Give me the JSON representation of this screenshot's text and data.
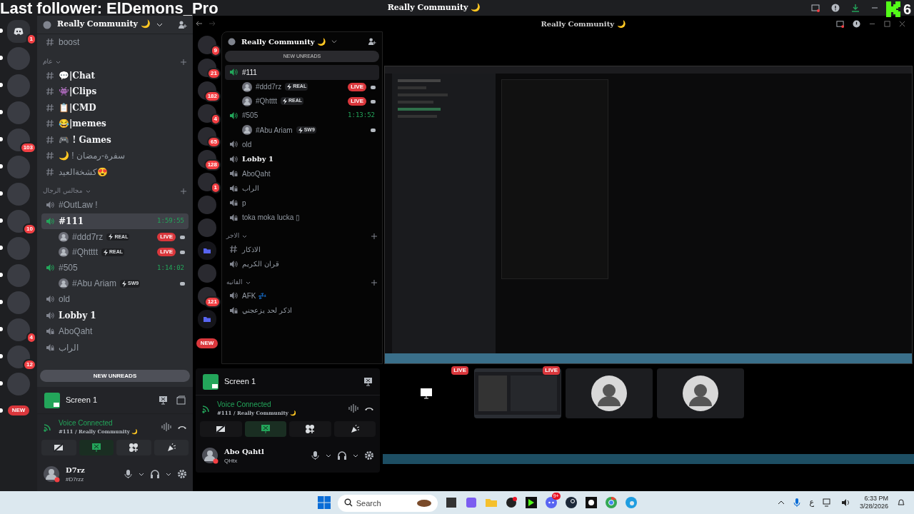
{
  "overlay": {
    "text": "Last follower: ElDemons_Pro",
    "follower_count": "6"
  },
  "title_bar": {
    "title": "Really Community 🌙"
  },
  "servers": [
    {
      "unread": true,
      "badge": "1",
      "kind": "home"
    },
    {
      "unread": true,
      "kind": "server"
    },
    {
      "unread": true,
      "kind": "server"
    },
    {
      "unread": true,
      "kind": "server"
    },
    {
      "unread": true,
      "badge": "103",
      "kind": "server"
    },
    {
      "unread": true,
      "kind": "server"
    },
    {
      "unread": true,
      "kind": "server"
    },
    {
      "unread": true,
      "badge": "10",
      "kind": "server"
    },
    {
      "unread": true,
      "kind": "server"
    },
    {
      "unread": true,
      "kind": "server"
    },
    {
      "unread": true,
      "kind": "server"
    },
    {
      "unread": true,
      "badge": "4",
      "kind": "server"
    },
    {
      "unread": true,
      "badge": "12",
      "kind": "server"
    },
    {
      "unread": true,
      "kind": "server"
    },
    {
      "unread": true,
      "badge": "NEW",
      "kind": "new-marker"
    }
  ],
  "sidebar": {
    "server_name": "Really Community 🌙",
    "new_unreads": "NEW UNREADS",
    "channels": [
      {
        "kind": "text",
        "name": "boost",
        "unread": false,
        "selected": false
      },
      {
        "kind": "category",
        "name": "عام"
      },
      {
        "kind": "text",
        "name": "💬|Chat",
        "unread": true,
        "selected": false
      },
      {
        "kind": "text",
        "name": "👾|Clips",
        "unread": true,
        "selected": false
      },
      {
        "kind": "text",
        "name": "📋|CMD",
        "unread": true,
        "selected": false
      },
      {
        "kind": "text",
        "name": "😂|memes",
        "unread": true,
        "selected": false
      },
      {
        "kind": "text",
        "name": "🎮 ! Games",
        "unread": true,
        "selected": false
      },
      {
        "kind": "text",
        "name": "🌙 ! سفرة-رمضان",
        "unread": false,
        "selected": false
      },
      {
        "kind": "text",
        "name": "كشخةالعيد😍",
        "unread": false,
        "selected": false
      },
      {
        "kind": "category",
        "name": "مجالس الرجال"
      },
      {
        "kind": "voice",
        "name": "#OutLaw !",
        "unread": false,
        "connected": false,
        "selected": false
      },
      {
        "kind": "voice",
        "name": "#111",
        "unread": true,
        "connected": true,
        "selected": true,
        "timer": "1:59:55"
      },
      {
        "kind": "member",
        "name": "#ddd7rz",
        "tag": "REAL",
        "live_badge": "LIVE"
      },
      {
        "kind": "member",
        "name": "#Qhtttt",
        "tag": "REAL",
        "live_badge": "LIVE"
      },
      {
        "kind": "voice",
        "name": "#505",
        "unread": false,
        "connected": true,
        "selected": false,
        "timer": "1:14:02"
      },
      {
        "kind": "member",
        "name": "#Abu Ariam",
        "tag": "SW9"
      },
      {
        "kind": "voice",
        "name": "old",
        "unread": false,
        "connected": false,
        "selected": false
      },
      {
        "kind": "voice",
        "name": "Lobby 1",
        "unread": true,
        "connected": false,
        "selected": false
      },
      {
        "kind": "locked",
        "name": "AboQaht",
        "unread": false,
        "selected": false
      },
      {
        "kind": "locked",
        "name": "الراب",
        "unread": false,
        "selected": false
      }
    ]
  },
  "voice_panel": {
    "stream_name": "Screen 1",
    "status": "Voice Connected",
    "channel": "#111 / Really Community 🌙",
    "user_name": "D7rz",
    "user_tag": "#D7rzz"
  },
  "stream": {
    "window_title": "Really Community 🌙",
    "servers": [
      {
        "badge": "9",
        "kind": "server"
      },
      {
        "badge": "21",
        "kind": "server"
      },
      {
        "badge": "182",
        "kind": "server"
      },
      {
        "badge": "4",
        "kind": "server"
      },
      {
        "badge": "65",
        "kind": "server"
      },
      {
        "badge": "128",
        "kind": "server"
      },
      {
        "badge": "1",
        "kind": "server"
      },
      {
        "kind": "server"
      },
      {
        "kind": "server"
      },
      {
        "kind": "folder"
      },
      {
        "kind": "server"
      },
      {
        "badge": "121",
        "kind": "server"
      },
      {
        "kind": "folder"
      },
      {
        "badge": "NEW",
        "kind": "new-marker"
      }
    ],
    "sidebar": {
      "server_name": "Really Community 🌙",
      "new_unreads": "NEW UNREADS",
      "channels": [
        {
          "kind": "voice",
          "name": "#111",
          "unread": false,
          "connected": true,
          "selected": true
        },
        {
          "kind": "member",
          "name": "#ddd7rz",
          "tag": "REAL",
          "live_badge": "LIVE"
        },
        {
          "kind": "member",
          "name": "#Qhtttt",
          "tag": "REAL",
          "live_badge": "LIVE"
        },
        {
          "kind": "voice",
          "name": "#505",
          "unread": false,
          "connected": true,
          "selected": false,
          "timer": "1:13:52"
        },
        {
          "kind": "member",
          "name": "#Abu Ariam",
          "tag": "SW9"
        },
        {
          "kind": "voice",
          "name": "old",
          "unread": false,
          "connected": false,
          "selected": false
        },
        {
          "kind": "voice",
          "name": "Lobby 1",
          "unread": true,
          "connected": false,
          "selected": false
        },
        {
          "kind": "locked",
          "name": "AboQaht",
          "unread": false,
          "selected": false
        },
        {
          "kind": "locked",
          "name": "الراب",
          "unread": false,
          "selected": false
        },
        {
          "kind": "locked",
          "name": "p",
          "unread": false,
          "selected": false
        },
        {
          "kind": "locked",
          "name": "toka moka lucka ▯",
          "unread": false,
          "selected": false
        },
        {
          "kind": "category",
          "name": "الاجر"
        },
        {
          "kind": "text",
          "name": "الاذكار",
          "unread": false,
          "selected": false
        },
        {
          "kind": "voice",
          "name": "قران الكريم",
          "unread": false,
          "connected": false,
          "selected": false
        },
        {
          "kind": "category",
          "name": "الفاتيه"
        },
        {
          "kind": "voice",
          "name": "AFK 💤",
          "unread": false,
          "connected": false,
          "selected": false
        },
        {
          "kind": "locked",
          "name": "اذكر لحد يزعجني",
          "unread": false,
          "selected": false
        }
      ]
    },
    "voice_panel": {
      "stream_name": "Screen 1",
      "status": "Voice Connected",
      "channel": "#111 / Really Community 🌙",
      "user_name": "Abo Qahtl",
      "user_tag": "QHtx"
    },
    "tiles": [
      {
        "kind": "screen",
        "live_badge": "LIVE"
      },
      {
        "kind": "video",
        "live_badge": "LIVE"
      },
      {
        "kind": "avatar"
      },
      {
        "kind": "avatar"
      }
    ]
  },
  "taskbar": {
    "search_placeholder": "Search",
    "discord_badge": "9+",
    "language": "ع",
    "time": "6:33 PM",
    "date": "3/28/2026"
  }
}
